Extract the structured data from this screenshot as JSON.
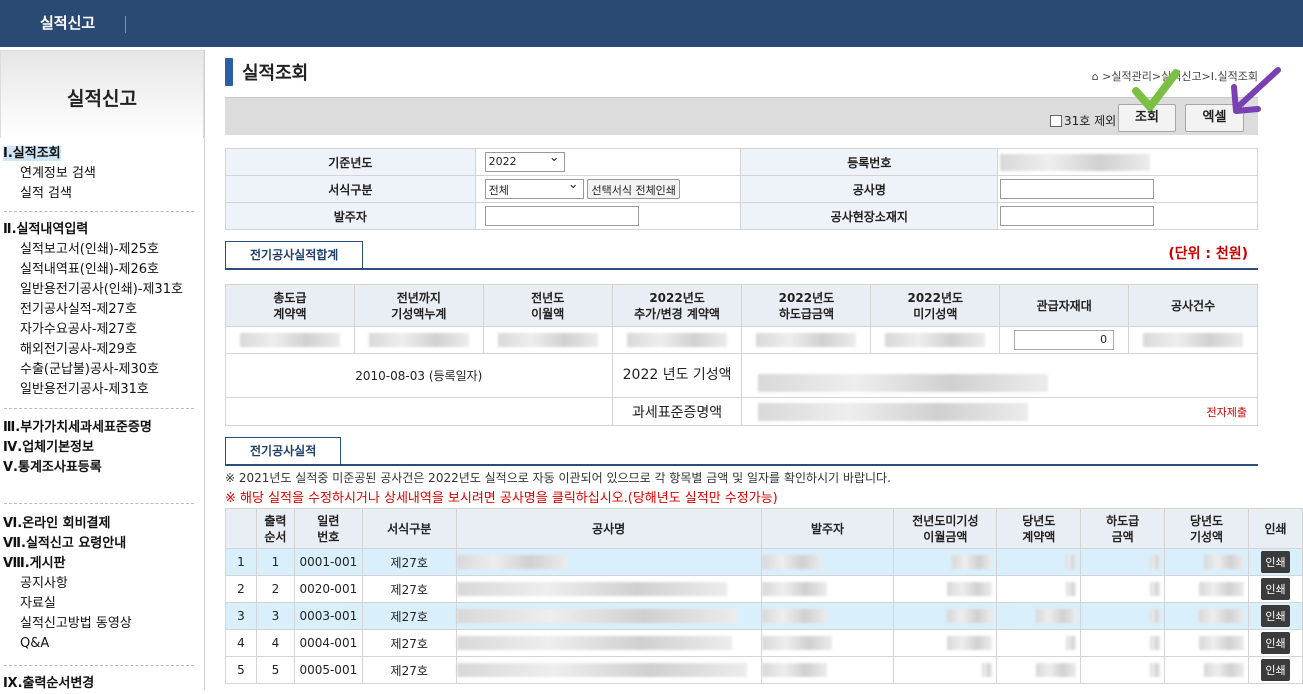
{
  "app": {
    "title": "실적신고"
  },
  "sidebar": {
    "title": "실적신고",
    "groups": [
      {
        "items": [
          "Ⅰ.실적조회",
          "연계정보 검색",
          "실적 검색"
        ]
      },
      {
        "items": [
          "Ⅱ.실적내역입력",
          "실적보고서(인쇄)-제25호",
          "실적내역표(인쇄)-제26호",
          "일반용전기공사(인쇄)-제31호",
          "전기공사실적-제27호",
          "자가수요공사-제27호",
          "해외전기공사-제29호",
          "수출(군납불)공사-제30호",
          "일반용전기공사-제31호"
        ]
      },
      {
        "items": [
          "Ⅲ.부가가치세과세표준증명",
          "Ⅳ.업체기본정보",
          "Ⅴ.통계조사표등록"
        ]
      },
      {
        "items": [
          "Ⅵ.온라인 회비결제",
          "Ⅶ.실적신고 요령안내",
          "Ⅷ.게시판",
          "공지사항",
          "자료실",
          "실적신고방법 동영상",
          "Q&A",
          "Ⅸ.출력순서변경"
        ]
      }
    ]
  },
  "page": {
    "title": "실적조회",
    "breadcrumb": "⌂ >실적관리>실적신고>Ⅰ.실적조회"
  },
  "toolbar": {
    "exclude31": "31호 제외",
    "search": "조회",
    "excel": "엑셀"
  },
  "form": {
    "year_label": "기준년도",
    "year_value": "2022",
    "reg_label": "등록번호",
    "type_label": "서식구분",
    "type_value": "전체",
    "print_all": "선택서식 전체인쇄",
    "project_label": "공사명",
    "client_label": "발주자",
    "site_label": "공사현장소재지"
  },
  "summary": {
    "tab": "전기공사실적합계",
    "unit": "(단위 : 천원)",
    "headers": [
      "총도급\n계약액",
      "전년까지\n기성액누계",
      "전년도\n이월액",
      "2022년도\n추가/변경 계약액",
      "2022년도\n하도급금액",
      "2022년도\n미기성액",
      "관급자재대",
      "공사건수"
    ],
    "material_value": "0",
    "reg_date": "2010-08-03 (등록일자)",
    "ytd_label": "2022 년도 기성액",
    "tax_label": "과세표준증명액",
    "e_submit": "전자제출"
  },
  "list": {
    "tab": "전기공사실적",
    "note": "※ 2021년도 실적중 미준공된 공사건은 2022년도 실적으로 자동 이관되어 있으므로 각 항목별 금액 및 일자를 확인하시기 바랍니다.",
    "note_red": "※ 해당 실적을 수정하시거나 상세내역을 보시려면 공사명을 클릭하십시오.(당해년도 실적만 수정가능)",
    "headers": [
      "",
      "출력\n순서",
      "일련\n번호",
      "서식구분",
      "공사명",
      "발주자",
      "전년도미기성\n이월금액",
      "당년도\n계약액",
      "하도급\n금액",
      "당년도\n기성액",
      "인쇄"
    ],
    "rows": [
      {
        "idx": "1",
        "order": "1",
        "serial": "0001-001",
        "form": "제27호"
      },
      {
        "idx": "2",
        "order": "2",
        "serial": "0020-001",
        "form": "제27호"
      },
      {
        "idx": "3",
        "order": "3",
        "serial": "0003-001",
        "form": "제27호"
      },
      {
        "idx": "4",
        "order": "4",
        "serial": "0004-001",
        "form": "제27호"
      },
      {
        "idx": "5",
        "order": "5",
        "serial": "0005-001",
        "form": "제27호"
      }
    ],
    "print_label": "인쇄"
  },
  "annotations": {
    "check_color": "#7bc043",
    "arrow_color": "#7a3fb3"
  }
}
